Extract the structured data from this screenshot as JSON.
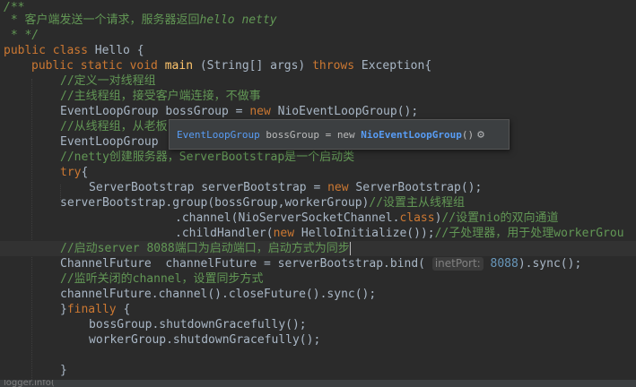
{
  "code": {
    "l1": "/**",
    "l2_star": " * ",
    "l2_cn": "客户端发送一个请求，服务器返回",
    "l2_tag": "hello netty",
    "l3": " * */",
    "l4_kw": "public class",
    "l4_rest": " Hello {",
    "l5_kw": "public static void",
    "l5_fn": "main",
    "l5_args": " (String[] args) ",
    "l5_throws": "throws",
    "l5_exc": " Exception{",
    "l6": "//定义一对线程组",
    "l7": "//主线程组，接受客户端连接，不做事",
    "l8_a": "EventLoopGroup bossGroup = ",
    "l8_new": "new",
    "l8_b": " NioEventLoopGroup();",
    "l9": "//从线程组，从老板",
    "l10": "EventLoopGroup",
    "l11": "//netty创建服务器，ServerBootstrap是一个启动类",
    "l12_try": "try",
    "l12_rest": "{",
    "l13_a": "ServerBootstrap serverBootstrap = ",
    "l13_new": "new",
    "l13_b": " ServerBootstrap();",
    "l14_a": "serverBootstrap.group(bossGroup,workerGroup)",
    "l14_c": "//设置主从线程组",
    "l15_a": ".channel(NioServerSocketChannel.",
    "l15_cls": "class",
    "l15_b": ")",
    "l15_c": "//设置nio的双向通道",
    "l16_a": ".childHandler(",
    "l16_new": "new",
    "l16_b": " HelloInitialize());",
    "l16_c": "//子处理器，用于处理workerGrou",
    "l17": "//启动server 8088端口为启动端口，启动方式为同步",
    "l18_a": "ChannelFuture  channelFuture = serverBootstrap.bind( ",
    "l18_hint": "inetPort:",
    "l18_num": " 8088",
    "l18_b": ").sync();",
    "l19": "//监听关闭的channel，设置同步方式",
    "l20": "channelFuture.channel().closeFuture().sync();",
    "l21_a": "}",
    "l21_kw": "finally",
    "l21_b": " {",
    "l22": "bossGroup.shutdownGracefully();",
    "l23": "workerGroup.shutdownGracefully();",
    "l25": "}",
    "l26": "    logger.info("
  },
  "tooltip": {
    "type": "EventLoopGroup",
    "var": " bossGroup = ",
    "kw": "new",
    "cls": " NioEventLoopGroup",
    "parens": "()",
    "icon": "gear-icon"
  },
  "colors": {
    "background": "#2b2b2b",
    "keyword": "#cc7832",
    "comment": "#629755",
    "method": "#ffc66d",
    "number": "#6897bb",
    "text": "#a9b7c6"
  }
}
